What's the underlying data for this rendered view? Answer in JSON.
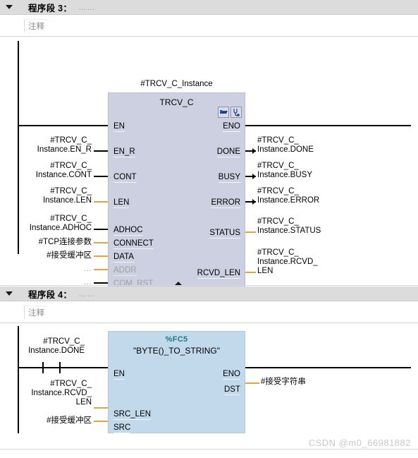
{
  "networks": [
    {
      "title": "程序段 3：",
      "dots": "……",
      "comment": "注释",
      "block": {
        "instance_label": "#TRCV_C_Instance",
        "name": "TRCV_C",
        "icons": [
          "open-block-icon",
          "watch-probe-icon"
        ],
        "inputs": [
          {
            "pin": "EN",
            "operand": "",
            "type": "bool",
            "dim": false
          },
          {
            "pin": "EN_R",
            "operand": "#TRCV_C_\nInstance.EN_R",
            "type": "bool",
            "dim": false
          },
          {
            "pin": "CONT",
            "operand": "#TRCV_C_\nInstance.CONT",
            "type": "bool",
            "dim": false
          },
          {
            "pin": "LEN",
            "operand": "#TRCV_C_\nInstance.LEN",
            "type": "data",
            "dim": false
          },
          {
            "pin": "ADHOC",
            "operand": "#TRCV_C_\nInstance.ADHOC",
            "type": "bool",
            "dim": false
          },
          {
            "pin": "CONNECT",
            "operand": "#TCP连接参数",
            "type": "data",
            "dim": false
          },
          {
            "pin": "DATA",
            "operand": "#接受缓冲区",
            "type": "data",
            "dim": false
          },
          {
            "pin": "ADDR",
            "operand": "…",
            "type": "data",
            "dim": true
          },
          {
            "pin": "COM_RST",
            "operand": "…",
            "type": "bool",
            "dim": true
          }
        ],
        "outputs": [
          {
            "pin": "ENO",
            "operand": "",
            "type": "bool",
            "dim": false
          },
          {
            "pin": "DONE",
            "operand": "#TRCV_C_\nInstance.DONE",
            "type": "bool",
            "dim": false
          },
          {
            "pin": "BUSY",
            "operand": "#TRCV_C_\nInstance.BUSY",
            "type": "bool",
            "dim": false
          },
          {
            "pin": "ERROR",
            "operand": "#TRCV_C_\nInstance.ERROR",
            "type": "bool",
            "dim": false
          },
          {
            "pin": "STATUS",
            "operand": "#TRCV_C_\nInstance.STATUS",
            "type": "data",
            "dim": false
          },
          {
            "pin": "RCVD_LEN",
            "operand": "#TRCV_C_\nInstance.RCVD_\nLEN",
            "type": "data",
            "dim": false
          }
        ]
      }
    },
    {
      "title": "程序段 4：",
      "dots": "……",
      "comment": "注释",
      "contact": {
        "operand": "#TRCV_C_\nInstance.DONE",
        "kind": "normally-open-contact"
      },
      "block": {
        "address": "%FC5",
        "name": "\"BYTE()_TO_STRING\"",
        "inputs": [
          {
            "pin": "EN",
            "operand": "",
            "type": "bool",
            "dim": false
          },
          {
            "pin": "SRC_LEN",
            "operand": "#TRCV_C_\nInstance.RCVD_\nLEN",
            "type": "data",
            "dim": false
          },
          {
            "pin": "SRC",
            "operand": "#接受缓冲区",
            "type": "data",
            "dim": false
          }
        ],
        "outputs": [
          {
            "pin": "ENO",
            "operand": "",
            "type": "bool",
            "dim": false
          },
          {
            "pin": "DST",
            "operand": "#接受字符串",
            "type": "data",
            "dim": false
          }
        ]
      }
    }
  ],
  "watermark": "CSDN @m0_66981882",
  "colors": {
    "header_bar": "#dcdcdc",
    "block_trcv": "#ccd0e0",
    "block_fc5": "#c2d9ec",
    "wire_bool": "#000000",
    "wire_data": "#e8a33d",
    "address_text": "#1a7a86",
    "dim_text": "#a0a0a0"
  }
}
